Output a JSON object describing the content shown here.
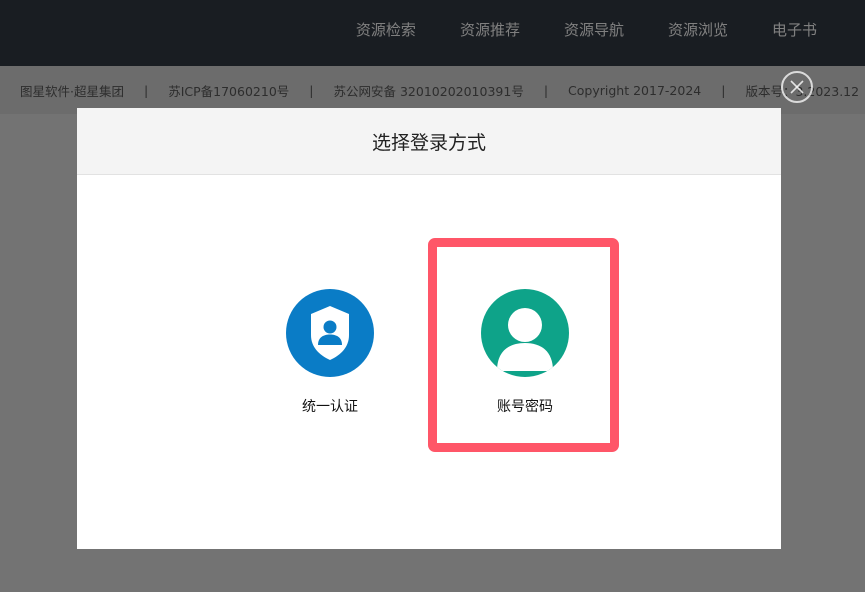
{
  "nav": {
    "items": [
      "资源检索",
      "资源推荐",
      "资源导航",
      "资源浏览",
      "电子书"
    ]
  },
  "footer": {
    "company": "图星软件·超星集团",
    "icp": "苏ICP备17060210号",
    "police": "苏公网安备  32010202010391号",
    "copyright": "Copyright  2017-2024",
    "version": "版本号：3.2023.12"
  },
  "dialog": {
    "title": "选择登录方式",
    "options": [
      {
        "label": "统一认证",
        "icon": "shield-user-icon",
        "color": "#0a7cc6"
      },
      {
        "label": "账号密码",
        "icon": "user-icon",
        "color": "#0ea389"
      }
    ]
  },
  "colors": {
    "highlight": "#ff5668"
  }
}
